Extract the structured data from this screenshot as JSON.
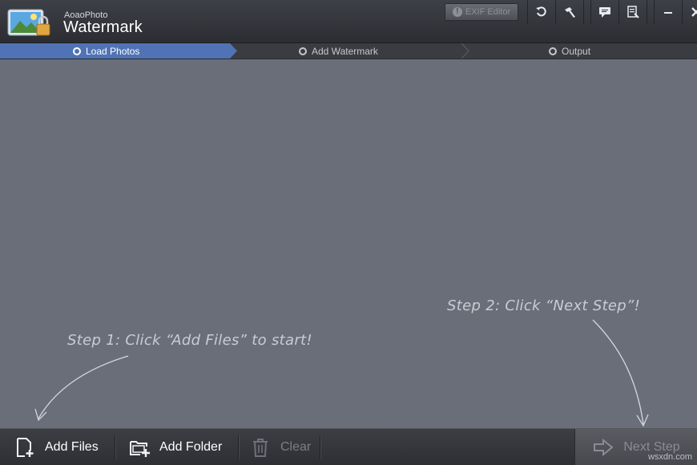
{
  "app": {
    "vendor": "AoaoPhoto",
    "title": "Watermark"
  },
  "toolbar": {
    "exif_label": "EXIF Editor",
    "icons": [
      "undo-icon",
      "hammer-icon",
      "chat-icon",
      "register-icon",
      "minimize-icon",
      "close-icon"
    ]
  },
  "steps": [
    {
      "label": "Load Photos",
      "active": true
    },
    {
      "label": "Add Watermark",
      "active": false
    },
    {
      "label": "Output",
      "active": false
    }
  ],
  "hints": {
    "step1": "Step 1: Click “Add Files” to start!",
    "step2": "Step 2: Click “Next Step”!"
  },
  "bottom": {
    "add_files": "Add Files",
    "add_folder": "Add Folder",
    "clear": "Clear",
    "next_step": "Next Step"
  },
  "watermark_text": "wsxdn.com",
  "colors": {
    "active_step": "#4f73b4",
    "main_bg": "#6a6e79",
    "titlebar": "#34363c"
  }
}
